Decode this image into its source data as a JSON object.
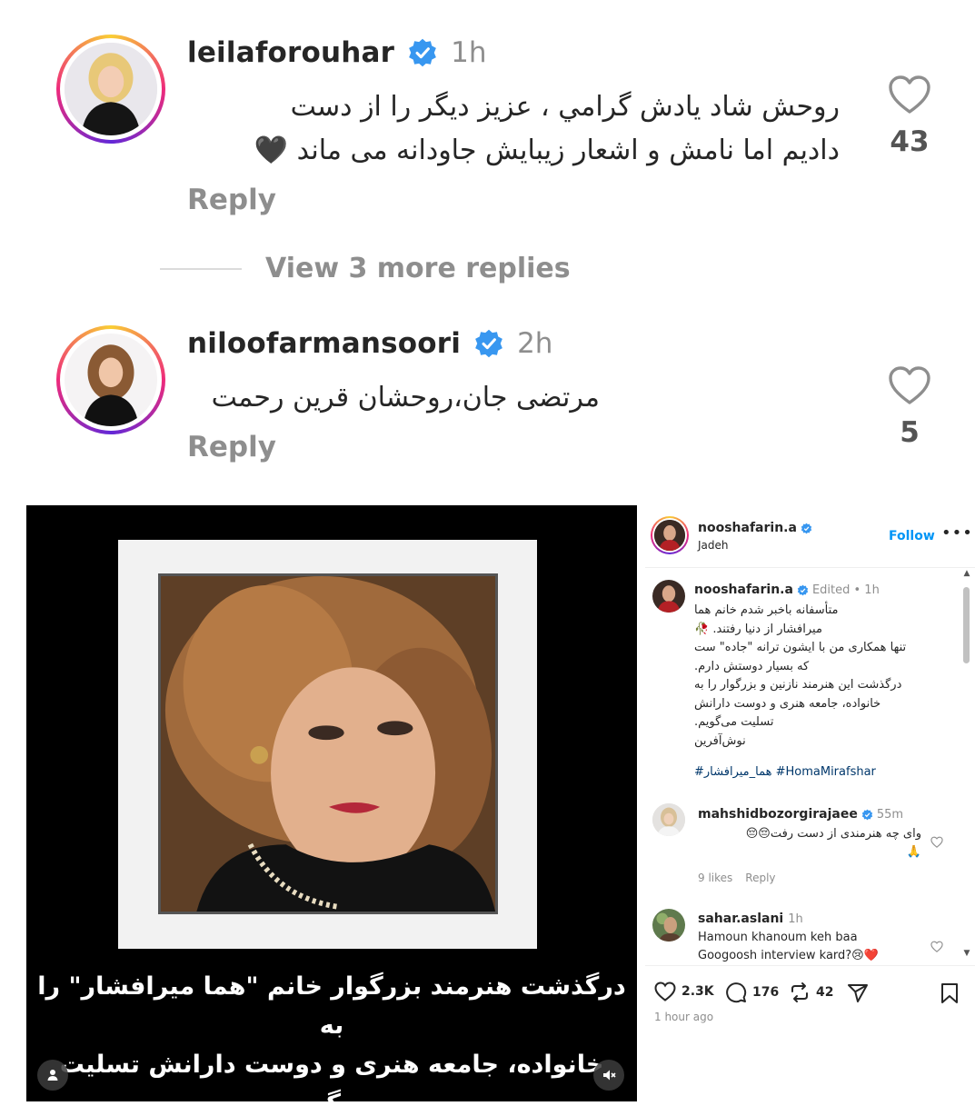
{
  "comments": [
    {
      "username": "leilaforouhar",
      "time": "1h",
      "text_lines": [
        "روحش شاد یادش گرامي ، عزیز دیگر را از دست",
        "دادیم اما نامش و اشعار زیبایش جاودانه می ماند 🖤"
      ],
      "reply_label": "Reply",
      "likes": "43"
    },
    {
      "username": "niloofarmansoori",
      "time": "2h",
      "text_lines": [
        "مرتضی جان،روحشان قرین رحمت"
      ],
      "reply_label": "Reply",
      "likes": "5"
    }
  ],
  "view_more_label": "View 3 more replies",
  "video": {
    "caption_lines": [
      "درگذشت هنرمند بزرگوار خانم \"هما میرافشار\" را به",
      "خانواده، جامعه هنری و دوست دارانش تسلیت می‌گویم"
    ]
  },
  "post": {
    "author": "nooshafarin.a",
    "audio": "Jadeh",
    "follow_label": "Follow",
    "more_label": "•••",
    "caption_author": "nooshafarin.a",
    "caption_meta": "Edited • 1h",
    "caption_lines": [
      "متأسفانه باخبر شدم خانم هما",
      "میرافشار از دنیا رفتند. 🥀",
      "تنها همکاری من با ایشون ترانه \"جاده\" ست",
      "که بسیار دوستش دارم.",
      "درگذشت این هنرمند نازنین و بزرگوار را به",
      "خانواده، جامعه هنری و دوست دارانش",
      "تسلیت می‌گویم.",
      "نوش‌آفرین"
    ],
    "hashtags": "#هما_میرافشار #HomaMirafshar",
    "replies": [
      {
        "username": "mahshidbozorgirajaee",
        "time": "55m",
        "text_lines": [
          "وای چه هنرمندی از دست رفت😔😔",
          "🙏"
        ],
        "likes_label": "9 likes",
        "reply_label": "Reply"
      },
      {
        "username": "sahar.aslani",
        "time": "1h",
        "text_lines": [
          "Hamoun khanoum keh baa",
          "Googoosh interview kard?😢❤️"
        ]
      }
    ],
    "like_count": "2.3K",
    "comment_count": "176",
    "repost_count": "42",
    "posted_ago": "1 hour ago"
  },
  "colors": {
    "verified_blue": "#3897f0",
    "link_blue": "#0095f6",
    "hashtag": "#00376b",
    "muted": "#8e8e8e"
  }
}
